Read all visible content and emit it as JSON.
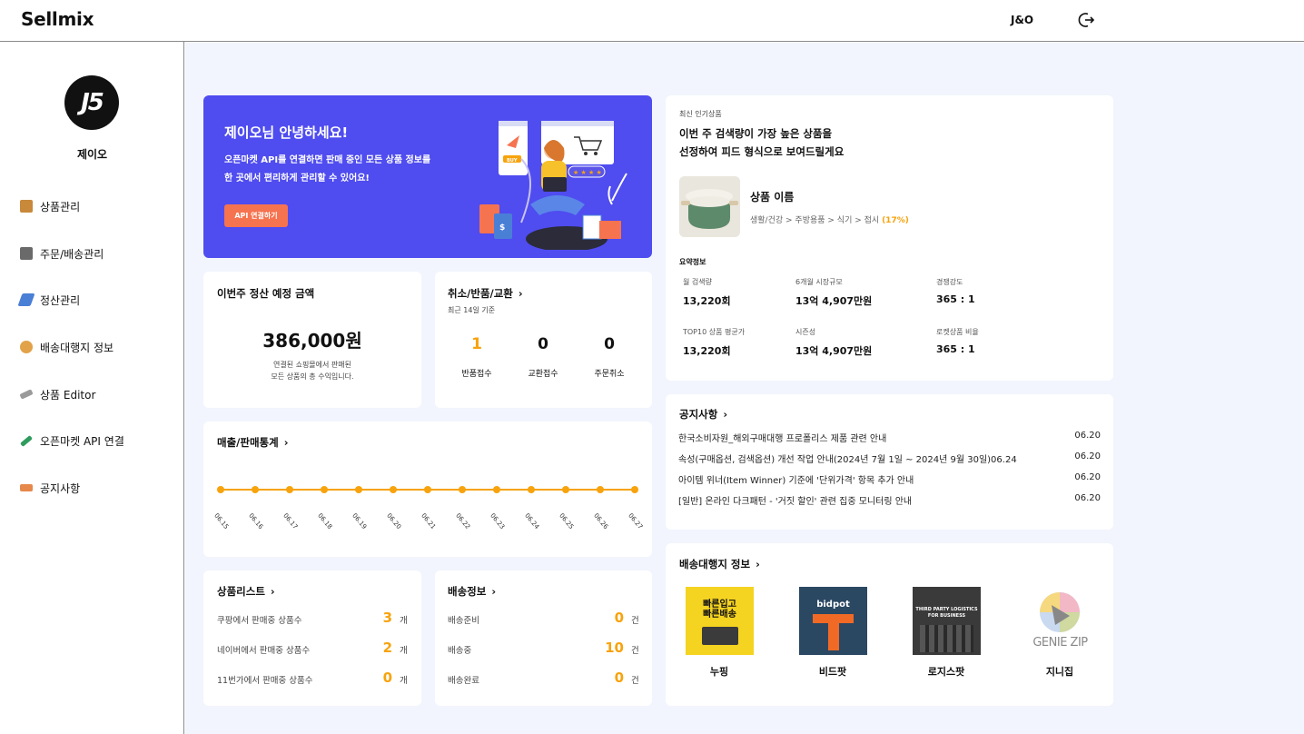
{
  "header": {
    "logo": "Sellmix",
    "user": "J&O"
  },
  "sidebar": {
    "avatar_text": "J5",
    "user_name": "제이오",
    "items": [
      {
        "label": "상품관리",
        "icon": "box-icon",
        "color": "#c8893a"
      },
      {
        "label": "주문/배송관리",
        "icon": "delivery-icon",
        "color": "#6a6a6a"
      },
      {
        "label": "정산관리",
        "icon": "money-icon",
        "color": "#4a7fd6"
      },
      {
        "label": "배송대행지 정보",
        "icon": "handshake-icon",
        "color": "#e2a24a"
      },
      {
        "label": "상품 Editor",
        "icon": "pencil-icon",
        "color": "#9a9a9a"
      },
      {
        "label": "오픈마켓 API 연결",
        "icon": "link-icon",
        "color": "#2f9c5e"
      },
      {
        "label": "공지사항",
        "icon": "megaphone-icon",
        "color": "#e6884a"
      }
    ]
  },
  "banner": {
    "title": "제이오님 안녕하세요!",
    "line1": "오픈마켓 API를 연결하면 판매 중인 모든 상품 정보를",
    "line2": "한 곳에서 편리하게 관리할 수 있어요!",
    "button": "API 연결하기",
    "buy_tag": "BUY"
  },
  "settlement": {
    "title": "이번주 정산 예정 금액",
    "amount": "386,000원",
    "desc1": "연결된 쇼핑몰에서 판매된",
    "desc2": "모든 상품의 총 수익입니다."
  },
  "returns": {
    "title": "취소/반품/교환",
    "subtitle": "최근 14일 기준",
    "items": [
      {
        "value": "1",
        "label": "반품접수",
        "highlight": true
      },
      {
        "value": "0",
        "label": "교환접수",
        "highlight": false
      },
      {
        "value": "0",
        "label": "주문취소",
        "highlight": false
      }
    ]
  },
  "sales": {
    "title": "매출/판매통계"
  },
  "chart_data": {
    "type": "line",
    "categories": [
      "06.15",
      "06.16",
      "06.17",
      "06.18",
      "06.19",
      "06.20",
      "06.21",
      "06.22",
      "06.23",
      "06.24",
      "06.25",
      "06.26",
      "06.27"
    ],
    "series": [
      {
        "values": [
          0,
          0,
          0,
          0,
          0,
          0,
          0,
          0,
          0,
          0,
          0,
          0,
          0
        ],
        "color": "#f7a30d"
      }
    ],
    "title": "",
    "xlabel": "",
    "ylabel": "",
    "grid": false
  },
  "product_list": {
    "title": "상품리스트",
    "rows": [
      {
        "label": "쿠팡에서 판매중 상품수",
        "value": "3",
        "unit": "개"
      },
      {
        "label": "네이버에서 판매중 상품수",
        "value": "2",
        "unit": "개"
      },
      {
        "label": "11번가에서 판매중 상품수",
        "value": "0",
        "unit": "개"
      }
    ]
  },
  "shipping": {
    "title": "배송정보",
    "rows": [
      {
        "label": "배송준비",
        "value": "0",
        "unit": "건"
      },
      {
        "label": "배송중",
        "value": "10",
        "unit": "건"
      },
      {
        "label": "배송완료",
        "value": "0",
        "unit": "건"
      }
    ]
  },
  "popular": {
    "eyebrow": "최신 인기상품",
    "headline1": "이번 주 검색량이 가장 높은 상품을",
    "headline2": "선정하여 피드 형식으로 보여드릴게요",
    "product_name": "상품 이름",
    "category": "생활/건강 > 주방용품 > 식기 > 접시",
    "category_pct": "(17%)",
    "summary_title": "요약정보",
    "stats": [
      {
        "label": "월 검색량",
        "value": "13,220회"
      },
      {
        "label": "6개월 시장규모",
        "value": "13억 4,907만원"
      },
      {
        "label": "경쟁강도",
        "value": "365 : 1"
      },
      {
        "label": "TOP10 상품 평균가",
        "value": "13,220회"
      },
      {
        "label": "시즌성",
        "value": "13억 4,907만원"
      },
      {
        "label": "로켓상품 비율",
        "value": "365 : 1"
      }
    ]
  },
  "notices": {
    "title": "공지사항",
    "items": [
      {
        "text": "한국소비자원_해외구매대행 프로폴리스 제품 관련 안내",
        "date": "06.20"
      },
      {
        "text": "속성(구매옵션, 검색옵션) 개선 작업 안내(2024년 7월 1일 ~ 2024년 9월 30일)06.24",
        "date": "06.20"
      },
      {
        "text": "아이템 위너(Item Winner) 기준에 '단위가격' 항목 추가 안내",
        "date": "06.20"
      },
      {
        "text": "[일반] 온라인 다크패턴 - '거짓 할인' 관련 집중 모니터링 안내",
        "date": "06.20"
      }
    ]
  },
  "agents": {
    "title": "배송대행지 정보",
    "items": [
      {
        "name": "누핑",
        "logo1": "빠른입고",
        "logo2": "빠른배송"
      },
      {
        "name": "비드팟",
        "logo1": "bidpot",
        "logo2": ""
      },
      {
        "name": "로지스팟",
        "logo1": "THIRD PARTY LOGISTICS",
        "logo2": "FOR BUSINESS"
      },
      {
        "name": "지니집",
        "logo1": "GENIE ZIP",
        "logo2": ""
      }
    ]
  }
}
